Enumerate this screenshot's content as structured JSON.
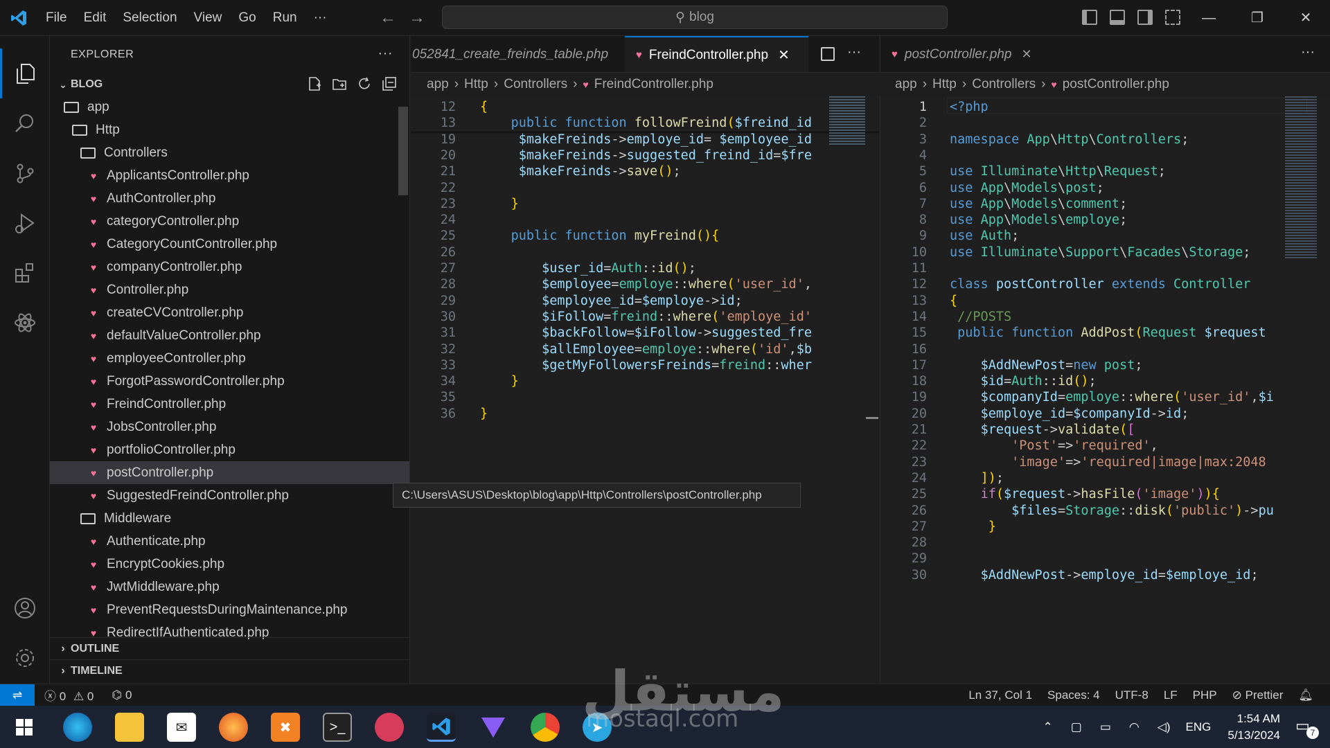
{
  "titlebar": {
    "menu": [
      "File",
      "Edit",
      "Selection",
      "View",
      "Go",
      "Run",
      "···"
    ],
    "search_text": "blog",
    "window_controls": [
      "—",
      "❐",
      "✕"
    ]
  },
  "sidebar": {
    "title": "EXPLORER",
    "more": "···",
    "root": "BLOG",
    "tree": [
      {
        "type": "folder",
        "label": "app",
        "depth": 0
      },
      {
        "type": "folder",
        "label": "Http",
        "depth": 1
      },
      {
        "type": "folder",
        "label": "Controllers",
        "depth": 2
      },
      {
        "type": "file",
        "label": "ApplicantsController.php",
        "depth": 3
      },
      {
        "type": "file",
        "label": "AuthController.php",
        "depth": 3
      },
      {
        "type": "file",
        "label": "categoryController.php",
        "depth": 3
      },
      {
        "type": "file",
        "label": "CategoryCountController.php",
        "depth": 3
      },
      {
        "type": "file",
        "label": "companyController.php",
        "depth": 3
      },
      {
        "type": "file",
        "label": "Controller.php",
        "depth": 3
      },
      {
        "type": "file",
        "label": "createCVController.php",
        "depth": 3
      },
      {
        "type": "file",
        "label": "defaultValueController.php",
        "depth": 3
      },
      {
        "type": "file",
        "label": "employeeController.php",
        "depth": 3
      },
      {
        "type": "file",
        "label": "ForgotPasswordController.php",
        "depth": 3
      },
      {
        "type": "file",
        "label": "FreindController.php",
        "depth": 3
      },
      {
        "type": "file",
        "label": "JobsController.php",
        "depth": 3
      },
      {
        "type": "file",
        "label": "portfolioController.php",
        "depth": 3
      },
      {
        "type": "file",
        "label": "postController.php",
        "depth": 3,
        "selected": true
      },
      {
        "type": "file",
        "label": "SuggestedFreindController.php",
        "depth": 3
      },
      {
        "type": "folder",
        "label": "Middleware",
        "depth": 2
      },
      {
        "type": "file",
        "label": "Authenticate.php",
        "depth": 3
      },
      {
        "type": "file",
        "label": "EncryptCookies.php",
        "depth": 3
      },
      {
        "type": "file",
        "label": "JwtMiddleware.php",
        "depth": 3
      },
      {
        "type": "file",
        "label": "PreventRequestsDuringMaintenance.php",
        "depth": 3
      },
      {
        "type": "file",
        "label": "RedirectIfAuthenticated.php",
        "depth": 3
      }
    ],
    "outline": "OUTLINE",
    "timeline": "TIMELINE"
  },
  "left_editor": {
    "tab_inactive": "052841_create_freinds_table.php",
    "tab_active": "FreindController.php",
    "crumbs": [
      "app",
      "Http",
      "Controllers",
      "FreindController.php"
    ],
    "sticky": [
      {
        "n": "12",
        "code": "{"
      },
      {
        "n": "13",
        "code": "    public function followFreind($freind_id"
      }
    ],
    "lines": [
      {
        "n": "19",
        "code": "     $makeFreinds->employe_id= $employee_id"
      },
      {
        "n": "20",
        "code": "     $makeFreinds->suggested_freind_id=$fre"
      },
      {
        "n": "21",
        "code": "     $makeFreinds->save();"
      },
      {
        "n": "22",
        "code": ""
      },
      {
        "n": "23",
        "code": "    }"
      },
      {
        "n": "24",
        "code": ""
      },
      {
        "n": "25",
        "code": "    public function myFreind(){"
      },
      {
        "n": "26",
        "code": ""
      },
      {
        "n": "27",
        "code": "        $user_id=Auth::id();"
      },
      {
        "n": "28",
        "code": "        $employee=employe::where('user_id',"
      },
      {
        "n": "29",
        "code": "        $employee_id=$employe->id;"
      },
      {
        "n": "30",
        "code": "        $iFollow=freind::where('employe_id'"
      },
      {
        "n": "31",
        "code": "        $backFollow=$iFollow->suggested_fre"
      },
      {
        "n": "32",
        "code": "        $allEmployee=employe::where('id',$b"
      },
      {
        "n": "33",
        "code": "        $getMyFollowersFreinds=freind::wher"
      },
      {
        "n": "34",
        "code": "    }"
      },
      {
        "n": "35",
        "code": ""
      },
      {
        "n": "36",
        "code": "}"
      }
    ]
  },
  "right_editor": {
    "tab": "postController.php",
    "crumbs": [
      "app",
      "Http",
      "Controllers",
      "postController.php"
    ],
    "lines": [
      {
        "n": "1",
        "code": "<?php"
      },
      {
        "n": "2",
        "code": ""
      },
      {
        "n": "3",
        "code": "namespace App\\Http\\Controllers;"
      },
      {
        "n": "4",
        "code": ""
      },
      {
        "n": "5",
        "code": "use Illuminate\\Http\\Request;"
      },
      {
        "n": "6",
        "code": "use App\\Models\\post;"
      },
      {
        "n": "7",
        "code": "use App\\Models\\comment;"
      },
      {
        "n": "8",
        "code": "use App\\Models\\employe;"
      },
      {
        "n": "9",
        "code": "use Auth;"
      },
      {
        "n": "10",
        "code": "use Illuminate\\Support\\Facades\\Storage;"
      },
      {
        "n": "11",
        "code": ""
      },
      {
        "n": "12",
        "code": "class postController extends Controller"
      },
      {
        "n": "13",
        "code": "{"
      },
      {
        "n": "14",
        "code": " //POSTS"
      },
      {
        "n": "15",
        "code": " public function AddPost(Request $request"
      },
      {
        "n": "16",
        "code": ""
      },
      {
        "n": "17",
        "code": "    $AddNewPost=new post;"
      },
      {
        "n": "18",
        "code": "    $id=Auth::id();"
      },
      {
        "n": "19",
        "code": "    $companyId=employe::where('user_id',$i"
      },
      {
        "n": "20",
        "code": "    $employe_id=$companyId->id;"
      },
      {
        "n": "21",
        "code": "    $request->validate(["
      },
      {
        "n": "22",
        "code": "        'Post'=>'required',"
      },
      {
        "n": "23",
        "code": "        'image'=>'required|image|max:2048"
      },
      {
        "n": "24",
        "code": "    ]);"
      },
      {
        "n": "25",
        "code": "    if($request->hasFile('image')){"
      },
      {
        "n": "26",
        "code": "        $files=Storage::disk('public')->pu"
      },
      {
        "n": "27",
        "code": "     }"
      },
      {
        "n": "28",
        "code": ""
      },
      {
        "n": "29",
        "code": ""
      },
      {
        "n": "30",
        "code": "    $AddNewPost->employe_id=$employe_id;"
      }
    ]
  },
  "tooltip": "C:\\Users\\ASUS\\Desktop\\blog\\app\\Http\\Controllers\\postController.php",
  "statusbar": {
    "errors": "0",
    "warnings": "0",
    "ports": "0",
    "position": "Ln 37, Col 1",
    "spaces": "Spaces: 4",
    "encoding": "UTF-8",
    "eol": "LF",
    "language": "PHP",
    "formatter": "Prettier"
  },
  "taskbar": {
    "lang": "ENG",
    "time": "1:54 AM",
    "date": "5/13/2024",
    "notifications": "7"
  },
  "watermark": {
    "arabic": "مستقل",
    "latin": "mostaql.com"
  }
}
